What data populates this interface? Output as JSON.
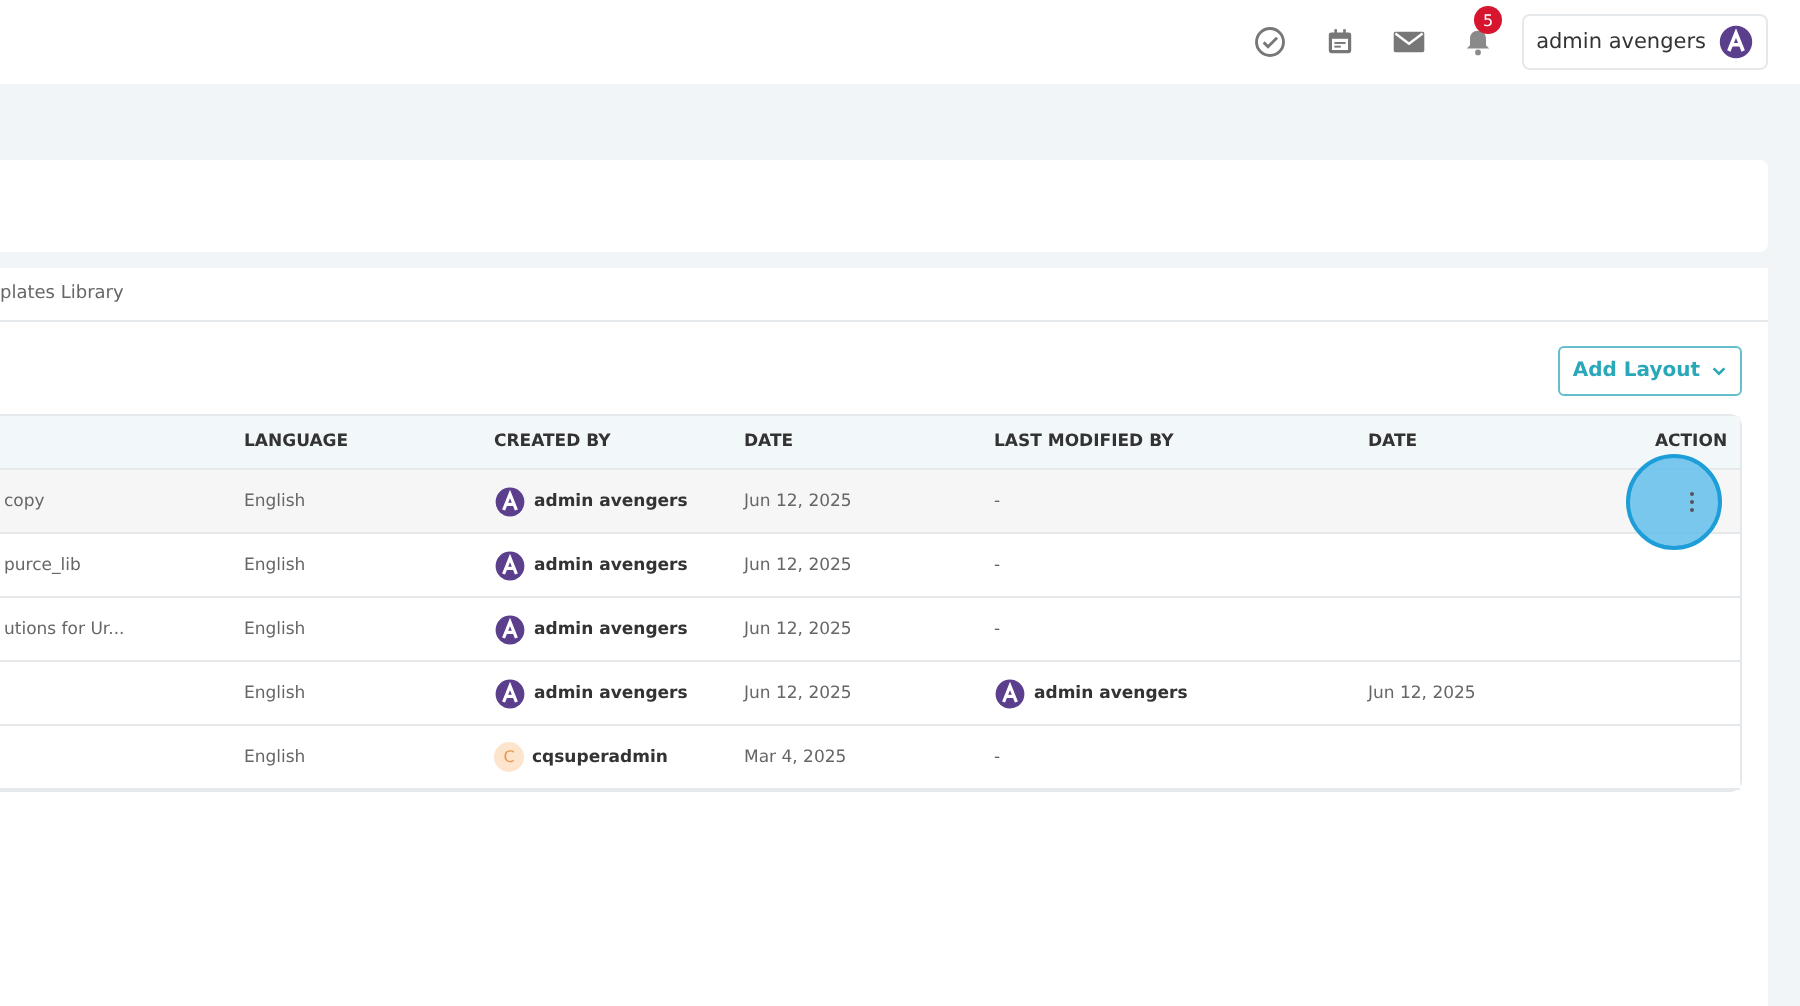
{
  "header": {
    "notification_count": "5",
    "user": {
      "name": "admin avengers"
    }
  },
  "breadcrumb": "plates Library",
  "add_button": "Add Layout",
  "table": {
    "columns": [
      "",
      "LANGUAGE",
      "CREATED BY",
      "DATE",
      "LAST MODIFIED BY",
      "DATE",
      "ACTION"
    ],
    "rows": [
      {
        "name": "copy",
        "language": "English",
        "created_by": {
          "name": "admin avengers",
          "avatar": {
            "kind": "logo"
          }
        },
        "date": "Jun 12, 2025",
        "last_modified_by": {
          "text": "-"
        },
        "modified_date": "",
        "highlighted": true,
        "clicked": true
      },
      {
        "name": "purce_lib",
        "language": "English",
        "created_by": {
          "name": "admin avengers",
          "avatar": {
            "kind": "logo"
          }
        },
        "date": "Jun 12, 2025",
        "last_modified_by": {
          "text": "-"
        },
        "highlighted": false,
        "clicked": false
      },
      {
        "name": "utions for Ur...",
        "language": "English",
        "created_by": {
          "name": "admin avengers",
          "avatar": {
            "kind": "logo"
          }
        },
        "date": "Jun 12, 2025",
        "last_modified_by": {
          "text": "-"
        },
        "highlighted": false,
        "clicked": false
      },
      {
        "name": "",
        "language": "English",
        "created_by": {
          "name": "admin avengers",
          "avatar": {
            "kind": "logo"
          }
        },
        "date": "Jun 12, 2025",
        "last_modified_by": {
          "name": "admin avengers",
          "avatar": {
            "kind": "logo"
          }
        },
        "modified_date": "Jun 12, 2025",
        "highlighted": false,
        "clicked": false
      },
      {
        "name": "",
        "language": "English",
        "created_by": {
          "name": "cqsuperadmin",
          "avatar": {
            "kind": "initial",
            "letter": "C"
          }
        },
        "date": "Mar 4, 2025",
        "last_modified_by": {
          "text": "-"
        },
        "highlighted": false,
        "clicked": false
      }
    ]
  }
}
